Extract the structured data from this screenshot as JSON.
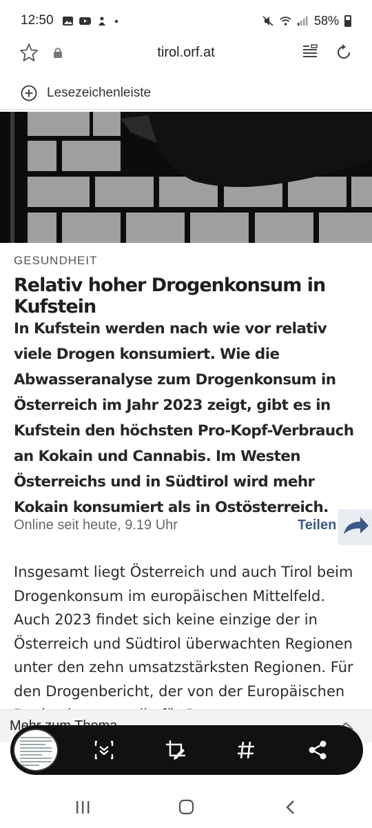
{
  "status_bar": {
    "time": "12:50",
    "battery": "58%",
    "left_icons": [
      "gallery-icon",
      "youtube-icon",
      "notification-icon",
      "dot-icon"
    ],
    "right_icons": [
      "mute-icon",
      "wifi-icon",
      "signal-icon",
      "battery-icon"
    ]
  },
  "browser": {
    "url": "tirol.orf.at",
    "bookmarks_label": "Lesezeichenleiste"
  },
  "article": {
    "category": "GESUNDHEIT",
    "title": "Relativ hoher Drogenkonsum in Kufstein",
    "lead": "In Kufstein werden nach wie vor relativ viele Drogen konsumiert. Wie die Abwasseranalyse zum Drogenkonsum in Österreich im Jahr 2023 zeigt, gibt es in Kufstein den höchsten Pro-Kopf-Verbrauch an Kokain und Cannabis. Im Westen Österreichs und in Südtirol wird mehr Kokain konsumiert als in Ostösterreich.",
    "dateline": "Online seit heute, 9.19 Uhr",
    "share_label": "Teilen",
    "body": "Insgesamt liegt Österreich und auch Tirol beim Drogenkonsum im europäischen Mittelfeld. Auch 2023 findet sich keine einzige der in Österreich und Südtirol überwachten Regionen unter den zehn umsatzstärksten Regionen. Für den Drogenbericht, der von der Europäischen Beobachtungsstelle für Drogen"
  },
  "related": {
    "label": "Mehr zum Thema"
  },
  "screenshot_toolbar": {
    "buttons": [
      "scroll-capture-icon",
      "crop-edit-icon",
      "hashtag-icon",
      "share-icon"
    ]
  },
  "colors": {
    "share_accent": "#3c5a87",
    "toolbar_bg": "#111111"
  }
}
